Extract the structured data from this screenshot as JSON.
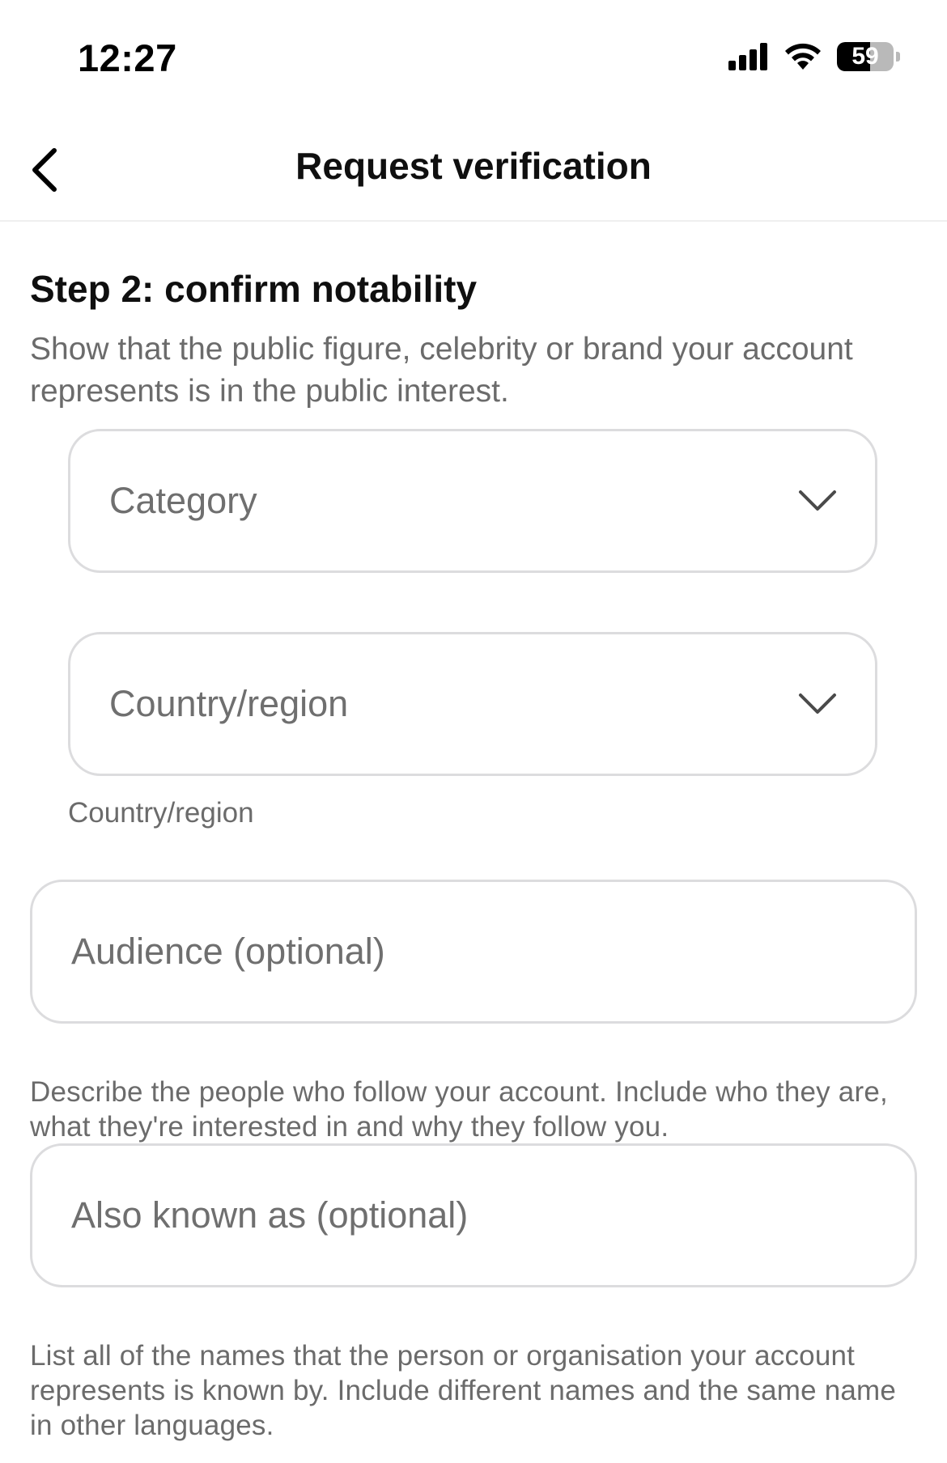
{
  "status_bar": {
    "time": "12:27",
    "battery_level": "59",
    "battery_fraction": 0.59,
    "icons": [
      "cellular-signal-icon",
      "wifi-icon",
      "battery-icon"
    ]
  },
  "header": {
    "title": "Request verification",
    "back_icon": "chevron-left-icon"
  },
  "step": {
    "title": "Step 2: confirm notability",
    "description": "Show that the public figure, celebrity or brand your account represents is in the public interest."
  },
  "form": {
    "category": {
      "label": "Category",
      "icon": "chevron-down-icon"
    },
    "country_region": {
      "label": "Country/region",
      "caption": "Country/region",
      "icon": "chevron-down-icon"
    },
    "audience": {
      "placeholder": "Audience (optional)",
      "help": "Describe the people who follow your account. Include who they are, what they're interested in and why they follow you."
    },
    "also_known_as": {
      "placeholder": "Also known as (optional)",
      "help": "List all of the names that the person or organisation your account represents is known by. Include different names and the same name in other languages."
    }
  },
  "colors": {
    "text_primary": "#0f0f0f",
    "text_secondary": "#6b6b6b",
    "field_border": "#dcdcde",
    "divider": "#efefef"
  }
}
